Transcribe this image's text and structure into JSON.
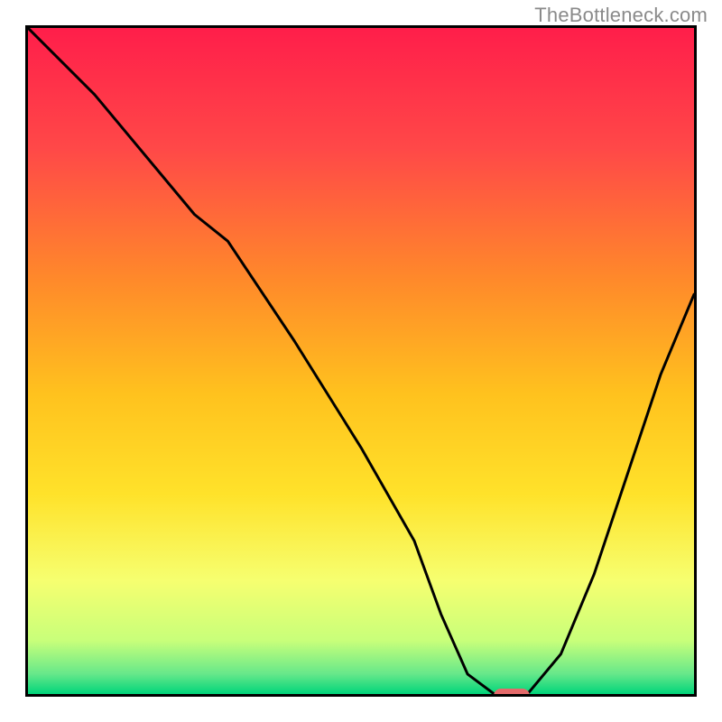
{
  "watermark": "TheBottleneck.com",
  "chart_data": {
    "type": "line",
    "title": "",
    "xlabel": "",
    "ylabel": "",
    "xlim": [
      0,
      100
    ],
    "ylim": [
      0,
      100
    ],
    "background_gradient": {
      "top": "#ff1e4a",
      "upper_mid": "#ff8a2a",
      "mid": "#ffe22a",
      "lower_mid": "#f6ff70",
      "bottom": "#00e676",
      "note": "red (high bottleneck) at top fading through orange, yellow, to green (low bottleneck) at bottom"
    },
    "series": [
      {
        "name": "bottleneck-curve",
        "x": [
          0,
          10,
          20,
          25,
          30,
          40,
          50,
          58,
          62,
          66,
          70,
          75,
          80,
          85,
          90,
          95,
          100
        ],
        "y": [
          100,
          90,
          78,
          72,
          68,
          53,
          37,
          23,
          12,
          3,
          0,
          0,
          6,
          18,
          33,
          48,
          60
        ]
      }
    ],
    "marker": {
      "name": "optimal-point",
      "x": 72,
      "y": 0,
      "color": "#e46a6a"
    }
  }
}
